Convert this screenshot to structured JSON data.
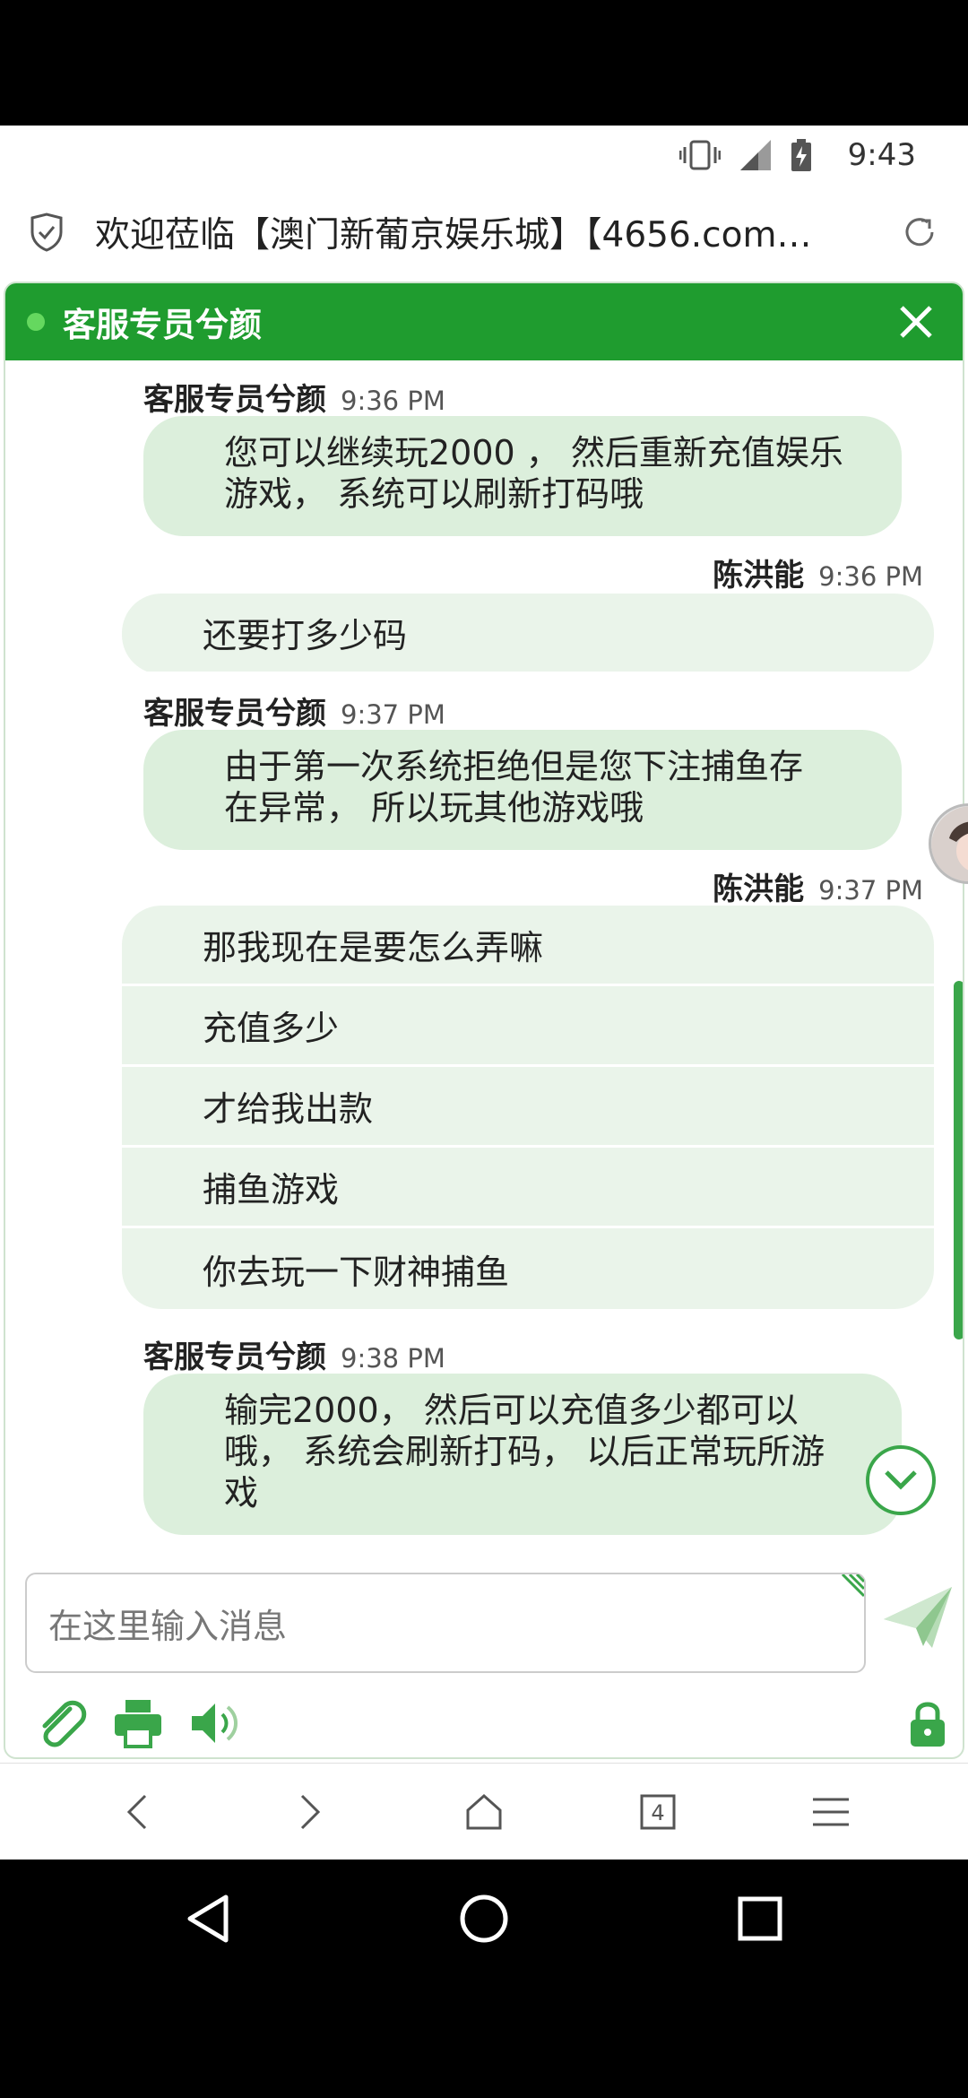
{
  "status_bar": {
    "time": "9:43"
  },
  "browser": {
    "page_title": "欢迎莅临【澳门新葡京娱乐城】【4656.com…",
    "tab_count": "4"
  },
  "chat": {
    "agent_name": "客服专员兮颜",
    "messages": [
      {
        "name": "客服专员兮颜",
        "time": "9:36 PM",
        "lines": [
          "您可以继续玩2000 ， 然后重新充值娱乐",
          "游戏， 系统可以刷新打码哦"
        ]
      },
      {
        "name": "陈洪能",
        "time": "9:36 PM",
        "lines": [
          "还要打多少码"
        ]
      },
      {
        "name": "客服专员兮颜",
        "time": "9:37 PM",
        "lines": [
          "由于第一次系统拒绝但是您下注捕鱼存",
          "在异常， 所以玩其他游戏哦"
        ]
      },
      {
        "name": "陈洪能",
        "time": "9:37 PM",
        "lines": [
          "那我现在是要怎么弄嘛",
          "充值多少",
          "才给我出款",
          "捕鱼游戏",
          "你去玩一下财神捕鱼"
        ]
      },
      {
        "name": "客服专员兮颜",
        "time": "9:38 PM",
        "lines": [
          "输完2000， 然后可以充值多少都可以",
          "哦， 系统会刷新打码， 以后正常玩所游",
          "戏"
        ]
      }
    ],
    "input_placeholder": "在这里输入消息"
  },
  "colors": {
    "header_green": "#1f9c2f",
    "agent_bubble": "#dcefdc",
    "user_bubble": "#eaf4ea"
  }
}
